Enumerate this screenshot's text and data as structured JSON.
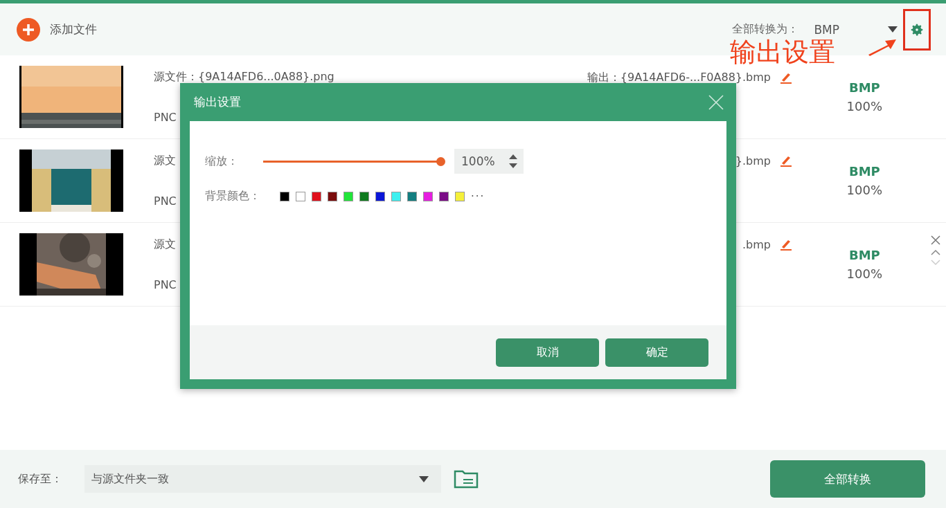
{
  "toolbar": {
    "add_label": "添加文件",
    "convert_all_label": "全部转换为：",
    "format_value": "BMP"
  },
  "annotation": {
    "text": "输出设置"
  },
  "files": [
    {
      "source": "源文件：{9A14AFD6...0A88}.png",
      "format": "PNC",
      "output": "输出：{9A14AFD6-...F0A88}.bmp",
      "target": "BMP",
      "scale": "100%",
      "controls": false
    },
    {
      "source": "源文",
      "format": "PNC",
      "output": "}.bmp",
      "target": "BMP",
      "scale": "100%",
      "controls": false
    },
    {
      "source": "源文",
      "format": "PNC",
      "output": ".bmp",
      "target": "BMP",
      "scale": "100%",
      "controls": true
    }
  ],
  "dialog": {
    "title": "输出设置",
    "zoom_label": "缩放：",
    "zoom": {
      "level": 1.0,
      "value": "100%"
    },
    "bg_label": "背景颜色：",
    "colors": [
      {
        "color": "#000000"
      },
      {
        "color": "#ffffff"
      },
      {
        "color": "#e0101c"
      },
      {
        "color": "#7a0c0c"
      },
      {
        "color": "#22e53a"
      },
      {
        "color": "#0f7a1e"
      },
      {
        "color": "#0a16d8"
      },
      {
        "color": "#3ef0f0"
      },
      {
        "color": "#137e80"
      },
      {
        "color": "#e61ee0"
      },
      {
        "color": "#7a0c86"
      },
      {
        "color": "#f5f03a"
      }
    ],
    "more": "···",
    "buttons": [
      "取消",
      "确定"
    ]
  },
  "footer": {
    "save_label": "保存至：",
    "save_value": "与源文件夹一致",
    "convert_button": "全部转换"
  }
}
